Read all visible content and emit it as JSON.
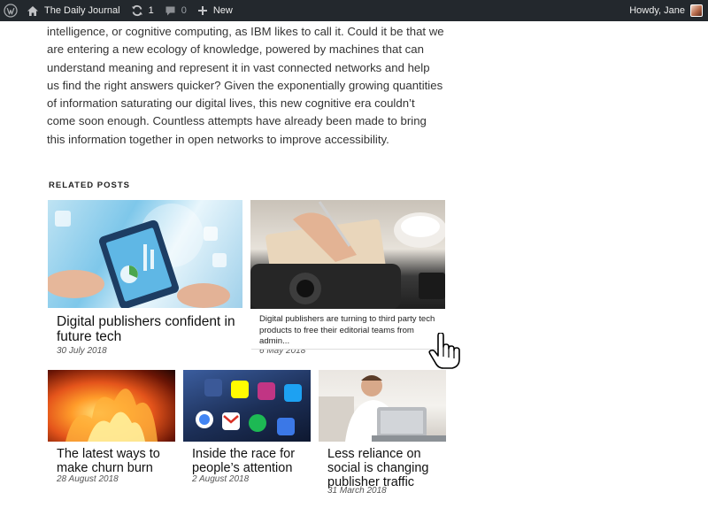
{
  "adminbar": {
    "site_name": "The Daily Journal",
    "updates_count": "1",
    "comments_count": "0",
    "new_label": "New",
    "greeting": "Howdy, Jane"
  },
  "article": {
    "text": "intelligence, or cognitive computing, as IBM likes to call it. Could it be that we are entering a new ecology of knowledge, powered by machines that can understand meaning and represent it in vast connected networks and help us find the right answers quicker? Given the exponentially growing quantities of information saturating our digital lives, this new cognitive era couldn’t come soon enough. Countless attempts have already been made to bring this information together in open networks to improve accessibility."
  },
  "related": {
    "heading": "RELATED POSTS",
    "posts": [
      {
        "title": "Digital publishers confident in future tech",
        "date": "30 July 2018"
      },
      {
        "title": "",
        "date": "6 May 2018",
        "excerpt": "Digital publishers are turning to third party tech products to free their editorial teams from admin..."
      },
      {
        "title": "The latest ways to make churn burn",
        "date": "28 August 2018"
      },
      {
        "title": "Inside the race for people’s attention",
        "date": "2 August 2018"
      },
      {
        "title": "Less reliance on social is changing publisher traffic",
        "date": "31 March 2018"
      }
    ]
  },
  "icons": {
    "wordpress": "wordpress-logo-icon",
    "home": "home-icon",
    "updates": "updates-icon",
    "comments": "comment-icon",
    "new": "plus-icon",
    "cursor": "hand-pointer-icon"
  },
  "colors": {
    "adminbar_bg": "#23282d",
    "text": "#333333"
  }
}
